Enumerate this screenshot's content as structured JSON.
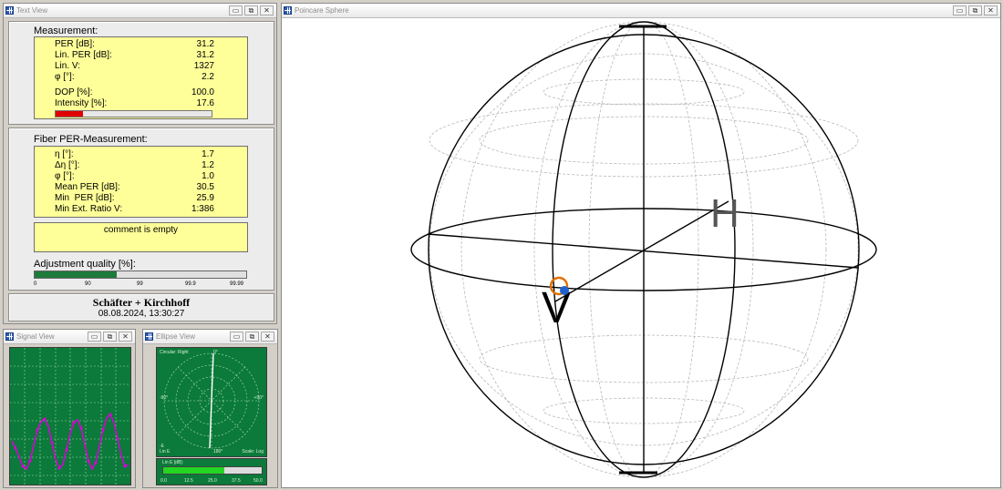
{
  "windows": {
    "text_view": "Text View",
    "poincare": "Poincare Sphere",
    "signal": "Signal View",
    "ellipse": "Ellipse View"
  },
  "controls": {
    "minimize": "▭",
    "maximize": "⧉",
    "close": "✕"
  },
  "measurement": {
    "heading": "Measurement:",
    "rows": [
      {
        "label": "PER [dB]:",
        "value": "31.2"
      },
      {
        "label": "Lin. PER [dB]:",
        "value": "31.2"
      },
      {
        "label": "Lin. V:",
        "value": "1327"
      },
      {
        "label": "φ [°]:",
        "value": "2.2"
      },
      {
        "label": "DOP [%]:",
        "value": "100.0"
      },
      {
        "label": "Intensity [%]:",
        "value": "17.6"
      }
    ],
    "intensity_fraction": 0.176
  },
  "fiber": {
    "heading": "Fiber PER-Measurement:",
    "rows": [
      {
        "label": "η [°]:",
        "value": "1.7"
      },
      {
        "label": "Δη [°]:",
        "value": "1.2"
      },
      {
        "label": "φ [°]:",
        "value": "1.0"
      },
      {
        "label": "Mean PER [dB]:",
        "value": "30.5"
      },
      {
        "label": "Min  PER [dB]:",
        "value": "25.9"
      },
      {
        "label": "Min Ext. Ratio V:",
        "value": "1:386"
      }
    ],
    "comment": "comment is empty"
  },
  "adjustment": {
    "heading": "Adjustment quality [%]:",
    "ticks": [
      "0",
      "90",
      "99",
      "99.9",
      "99.99"
    ],
    "fill_fraction": 0.39
  },
  "footer": {
    "company": "Schäfter + Kirchhoff",
    "datetime": "08.08.2024, 13:30:27"
  },
  "ellipse_view": {
    "circular": "Circular: Right",
    "top": "0°",
    "left": "-90°",
    "right": "+90°",
    "bottom": "180°",
    "bl1": "-E",
    "bl2": "Lin E",
    "scale": "Scale: Log",
    "lin_label": "Lin E [dB]:",
    "lin_ticks": [
      "0.0",
      "12.5",
      "25.0",
      "37.5",
      "50.0"
    ],
    "lin_fraction": 0.62
  },
  "sphere": {
    "label_h": "H",
    "label_v": "V"
  },
  "colors": {
    "scope": "#0b7a3a",
    "signal": "#d900d9",
    "panel": "#ffff99",
    "bar_red": "#e00000",
    "bar_green": "#1d7a3a"
  }
}
